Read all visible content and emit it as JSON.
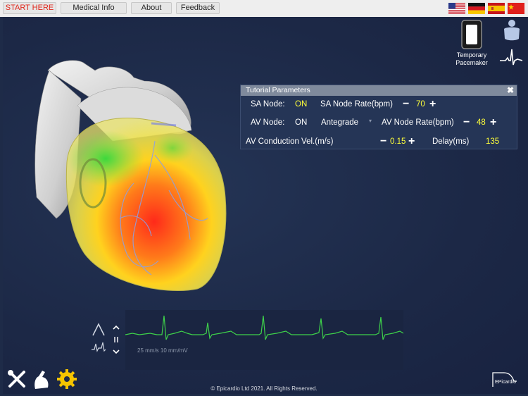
{
  "nav": {
    "start_here": "START HERE",
    "medical_info": "Medical Info",
    "about": "About",
    "feedback": "Feedback"
  },
  "languages": [
    "English (US flag)",
    "German",
    "Spanish",
    "Chinese"
  ],
  "right_panel": {
    "pacemaker_label_line1": "Temporary",
    "pacemaker_label_line2": "Pacemaker"
  },
  "tutorial": {
    "title": "Tutorial Parameters",
    "close": "✖",
    "sa_node_label": "SA Node:",
    "sa_node_state": "ON",
    "sa_rate_label": "SA Node Rate(bpm)",
    "sa_rate_value": "70",
    "av_node_label": "AV Node:",
    "av_node_state": "ON",
    "av_direction": "Antegrade",
    "av_rate_label": "AV Node Rate(bpm)",
    "av_rate_value": "48",
    "av_cond_label": "AV Conduction Vel.(m/s)",
    "av_cond_value": "0.15",
    "delay_label": "Delay(ms)",
    "delay_value": "135",
    "minus": "−",
    "plus": "+"
  },
  "ecg": {
    "caption": "25 mm/s   10 mm/mV",
    "trace_color": "#3ed24a"
  },
  "bottom_tools": [
    "tools-icon",
    "hand-probe-icon",
    "settings-gear-icon"
  ],
  "accent": {
    "gear": "#f5c400",
    "value": "#ffff3a",
    "start": "#e0261a"
  },
  "footer": "© Epicardio Ltd 2021. All Rights Reserved.",
  "logo_text": "EPicardio"
}
